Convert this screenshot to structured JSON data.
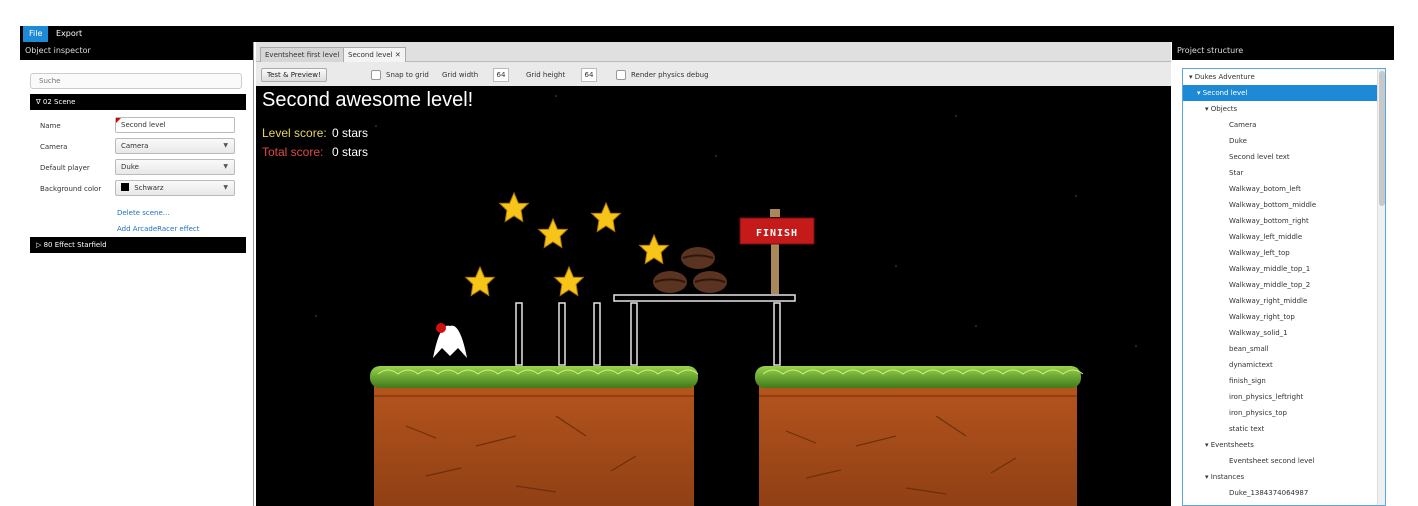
{
  "menu": {
    "file": "File",
    "export": "Export"
  },
  "inspector": {
    "header": "Object inspector",
    "search_placeholder": "Suche",
    "scene_section": "∇ 02 Scene",
    "props": {
      "name_label": "Name",
      "name_value": "Second level",
      "camera_label": "Camera",
      "camera_value": "Camera",
      "player_label": "Default player",
      "player_value": "Duke",
      "bg_label": "Background color",
      "bg_value": "Schwarz"
    },
    "delete_scene": "Delete scene...",
    "add_effect": "Add ArcadeRacer effect",
    "effect_section": "▷ 80 Effect Starfield"
  },
  "editor": {
    "tabs": [
      {
        "label": "Eventsheet first level"
      },
      {
        "label": "Second level ✕"
      }
    ],
    "toolbar": {
      "test_button": "Test & Preview!",
      "snap_label": "Snap to grid",
      "grid_width_label": "Grid width",
      "grid_width_value": "64",
      "grid_height_label": "Grid height",
      "grid_height_value": "64",
      "physics_label": "Render physics debug"
    },
    "canvas": {
      "level_title": "Second awesome level!",
      "level_score_label": "Level score:",
      "level_score_value": "0 stars",
      "total_score_label": "Total score:",
      "total_score_value": "0 stars",
      "finish_sign_text": "FINISH"
    }
  },
  "project": {
    "header": "Project structure",
    "tree": [
      {
        "label": "▾ Dukes Adventure",
        "depth": 0
      },
      {
        "label": "▾ Second level",
        "depth": 1,
        "selected": true
      },
      {
        "label": "▾ Objects",
        "depth": 2
      },
      {
        "label": "Camera",
        "depth": 3
      },
      {
        "label": "Duke",
        "depth": 3
      },
      {
        "label": "Second level text",
        "depth": 3
      },
      {
        "label": "Star",
        "depth": 3
      },
      {
        "label": "Walkway_botom_left",
        "depth": 3
      },
      {
        "label": "Walkway_bottom_middle",
        "depth": 3
      },
      {
        "label": "Walkway_bottom_right",
        "depth": 3
      },
      {
        "label": "Walkway_left_middle",
        "depth": 3
      },
      {
        "label": "Walkway_left_top",
        "depth": 3
      },
      {
        "label": "Walkway_middle_top_1",
        "depth": 3
      },
      {
        "label": "Walkway_middle_top_2",
        "depth": 3
      },
      {
        "label": "Walkway_right_middle",
        "depth": 3
      },
      {
        "label": "Walkway_right_top",
        "depth": 3
      },
      {
        "label": "Walkway_solid_1",
        "depth": 3
      },
      {
        "label": "bean_small",
        "depth": 3
      },
      {
        "label": "dynamictext",
        "depth": 3
      },
      {
        "label": "finish_sign",
        "depth": 3
      },
      {
        "label": "iron_physics_leftright",
        "depth": 3
      },
      {
        "label": "iron_physics_top",
        "depth": 3
      },
      {
        "label": "static text",
        "depth": 3
      },
      {
        "label": "▾ Eventsheets",
        "depth": 2
      },
      {
        "label": "Eventsheet second level",
        "depth": 3
      },
      {
        "label": "▾ Instances",
        "depth": 2
      },
      {
        "label": "Duke_1384374064987",
        "depth": 3
      }
    ]
  },
  "colors": {
    "accent": "#1e8ad6",
    "level_score": "#e6d45a",
    "total_score": "#e04848"
  }
}
